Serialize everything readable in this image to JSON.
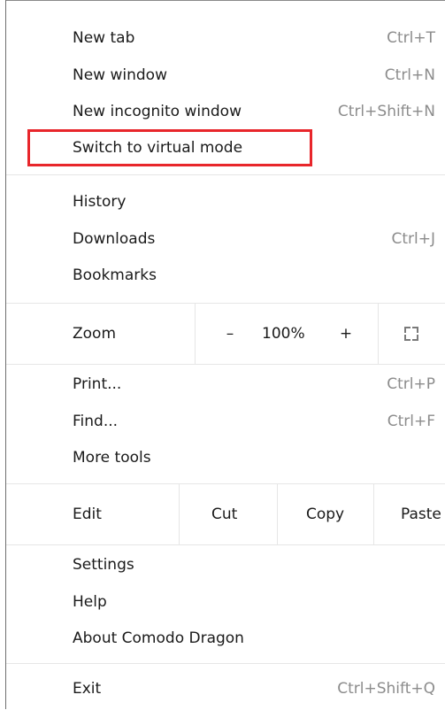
{
  "menu": {
    "new_tab": {
      "label": "New tab",
      "shortcut": "Ctrl+T"
    },
    "new_window": {
      "label": "New window",
      "shortcut": "Ctrl+N"
    },
    "new_incognito": {
      "label": "New incognito window",
      "shortcut": "Ctrl+Shift+N"
    },
    "virtual_mode": {
      "label": "Switch to virtual mode"
    },
    "history": {
      "label": "History"
    },
    "downloads": {
      "label": "Downloads",
      "shortcut": "Ctrl+J"
    },
    "bookmarks": {
      "label": "Bookmarks"
    },
    "zoom": {
      "label": "Zoom",
      "minus": "–",
      "value": "100%",
      "plus": "+"
    },
    "print": {
      "label": "Print...",
      "shortcut": "Ctrl+P"
    },
    "find": {
      "label": "Find...",
      "shortcut": "Ctrl+F"
    },
    "more_tools": {
      "label": "More tools"
    },
    "edit": {
      "label": "Edit",
      "cut": "Cut",
      "copy": "Copy",
      "paste": "Paste"
    },
    "settings": {
      "label": "Settings"
    },
    "help": {
      "label": "Help"
    },
    "about": {
      "label": "About Comodo Dragon"
    },
    "exit": {
      "label": "Exit",
      "shortcut": "Ctrl+Shift+Q"
    }
  },
  "colors": {
    "highlight_border": "#e8262b",
    "shortcut_text": "#8c8c8c",
    "separator": "#e6e6e6"
  },
  "icons": {
    "fullscreen": "fullscreen-icon"
  }
}
